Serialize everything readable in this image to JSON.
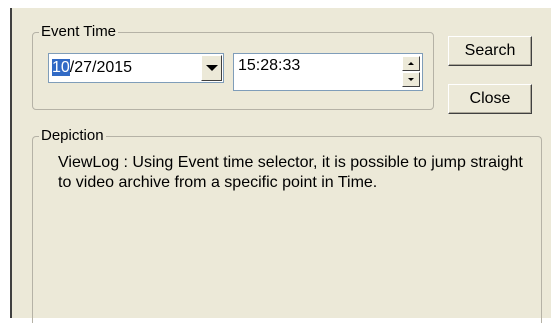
{
  "event_time": {
    "group_label": "Event Time",
    "date": {
      "selected": "10",
      "rest": "/27/2015"
    },
    "time": "15:28:33"
  },
  "buttons": {
    "search": "Search",
    "close": "Close"
  },
  "depiction": {
    "group_label": "Depiction",
    "text": "ViewLog : Using Event time selector, it is possible to jump straight to video archive from a specific point in Time."
  },
  "icons": {
    "dropdown": "chevron-down-icon",
    "spin_up": "arrow-up-icon",
    "spin_down": "arrow-down-icon"
  },
  "colors": {
    "dialog_background": "#ece9d8",
    "selection_highlight": "#316ac5",
    "input_border": "#7f9db9"
  }
}
